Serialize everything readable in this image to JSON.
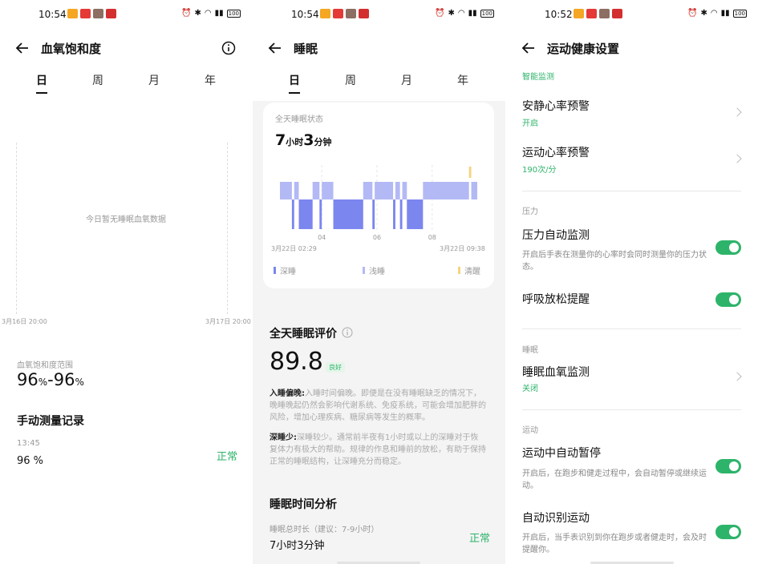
{
  "panel1": {
    "status": {
      "time": "10:54",
      "battery": "100"
    },
    "title": "血氧饱和度",
    "tabs": [
      "日",
      "周",
      "月",
      "年"
    ],
    "chart_data": {
      "type": "line",
      "empty_message": "今日暂无睡眠血氧数据",
      "x_start_label": "3月16日 20:00",
      "x_end_label": "3月17日 20:00",
      "series": []
    },
    "range_label": "血氧饱和度范围",
    "range_low": "96",
    "range_high": "96",
    "unit": "%",
    "range_dash": "-",
    "manual_title": "手动测量记录",
    "record": {
      "time": "13:45",
      "value": "96 %",
      "status": "正常"
    }
  },
  "panel2": {
    "status": {
      "time": "10:54",
      "battery": "100"
    },
    "title": "睡眠",
    "tabs": [
      "日",
      "周",
      "月",
      "年"
    ],
    "card_label": "全天睡眠状态",
    "duration": {
      "hours": "7",
      "hours_unit": "小时",
      "minutes": "3",
      "minutes_unit": "分钟"
    },
    "chart_data": {
      "type": "bar",
      "x_start": "3月22日 02:29",
      "x_end": "3月22日 09:38",
      "ticks": [
        "04",
        "06",
        "08"
      ],
      "legend": [
        {
          "name": "深睡",
          "color": "#7b86ef"
        },
        {
          "name": "浅睡",
          "color": "#b3b9f5"
        },
        {
          "name": "清醒",
          "color": "#f5d47e"
        }
      ],
      "segments": [
        {
          "stage": "light",
          "start": "02:29",
          "end": "02:55"
        },
        {
          "stage": "deep",
          "start": "02:55",
          "end": "03:00"
        },
        {
          "stage": "light",
          "start": "03:00",
          "end": "03:10"
        },
        {
          "stage": "deep",
          "start": "03:10",
          "end": "03:40"
        },
        {
          "stage": "light",
          "start": "03:40",
          "end": "03:55"
        },
        {
          "stage": "deep",
          "start": "03:55",
          "end": "04:00"
        },
        {
          "stage": "light",
          "start": "04:00",
          "end": "04:25"
        },
        {
          "stage": "deep",
          "start": "04:25",
          "end": "05:30"
        },
        {
          "stage": "light",
          "start": "05:30",
          "end": "05:50"
        },
        {
          "stage": "deep",
          "start": "05:50",
          "end": "05:55"
        },
        {
          "stage": "light",
          "start": "05:55",
          "end": "06:35"
        },
        {
          "stage": "deep",
          "start": "06:35",
          "end": "06:40"
        },
        {
          "stage": "light",
          "start": "06:40",
          "end": "06:50"
        },
        {
          "stage": "deep",
          "start": "06:50",
          "end": "06:55"
        },
        {
          "stage": "light",
          "start": "06:55",
          "end": "07:05"
        },
        {
          "stage": "deep",
          "start": "07:05",
          "end": "07:40"
        },
        {
          "stage": "light",
          "start": "07:40",
          "end": "09:20"
        },
        {
          "stage": "awake",
          "start": "09:20",
          "end": "09:25"
        },
        {
          "stage": "light",
          "start": "09:25",
          "end": "09:38"
        }
      ]
    },
    "eval_title": "全天睡眠评价",
    "score": "89.8",
    "score_badge": "良好",
    "para1": {
      "head": "入睡偏晚:",
      "body": "入睡时间偏晚。即便是在没有睡眠缺乏的情况下，晚睡晚起仍然会影响代谢系统、免疫系统，可能会增加肥胖的风险，增加心理疾病、糖尿病等发生的概率。"
    },
    "para2": {
      "head": "深睡少:",
      "body": "深睡较少。通常前半夜有1小时或以上的深睡对于恢复体力有极大的帮助。规律的作息和睡前的放松，有助于保持正常的睡眠结构，让深睡充分而稳定。"
    },
    "analysis_title": "睡眠时间分析",
    "total_label": "睡眠总时长（建议：7-9小时）",
    "total_value": "7小时3分钟",
    "total_status": "正常"
  },
  "panel3": {
    "status": {
      "time": "10:52",
      "battery": "100"
    },
    "title": "运动健康设置",
    "top_partial": "智能监测",
    "items": {
      "rest_hr": {
        "title": "安静心率预警",
        "sub": "开启"
      },
      "sport_hr": {
        "title": "运动心率预警",
        "sub": "190次/分"
      },
      "pressure_section": "压力",
      "pressure_auto": {
        "title": "压力自动监测",
        "desc": "开启后手表在测量你的心率时会同时测量你的压力状态。"
      },
      "relax": {
        "title": "呼吸放松提醒"
      },
      "sleep_section": "睡眠",
      "sleep_spo2": {
        "title": "睡眠血氧监测",
        "sub": "关闭"
      },
      "sport_section": "运动",
      "auto_pause": {
        "title": "运动中自动暂停",
        "desc": "开启后，在跑步和健走过程中，会自动暂停或继续运动。"
      },
      "auto_detect": {
        "title": "自动识别运动",
        "desc": "开启后，当手表识别到你在跑步或者健走时，会及时提醒你。"
      }
    }
  }
}
